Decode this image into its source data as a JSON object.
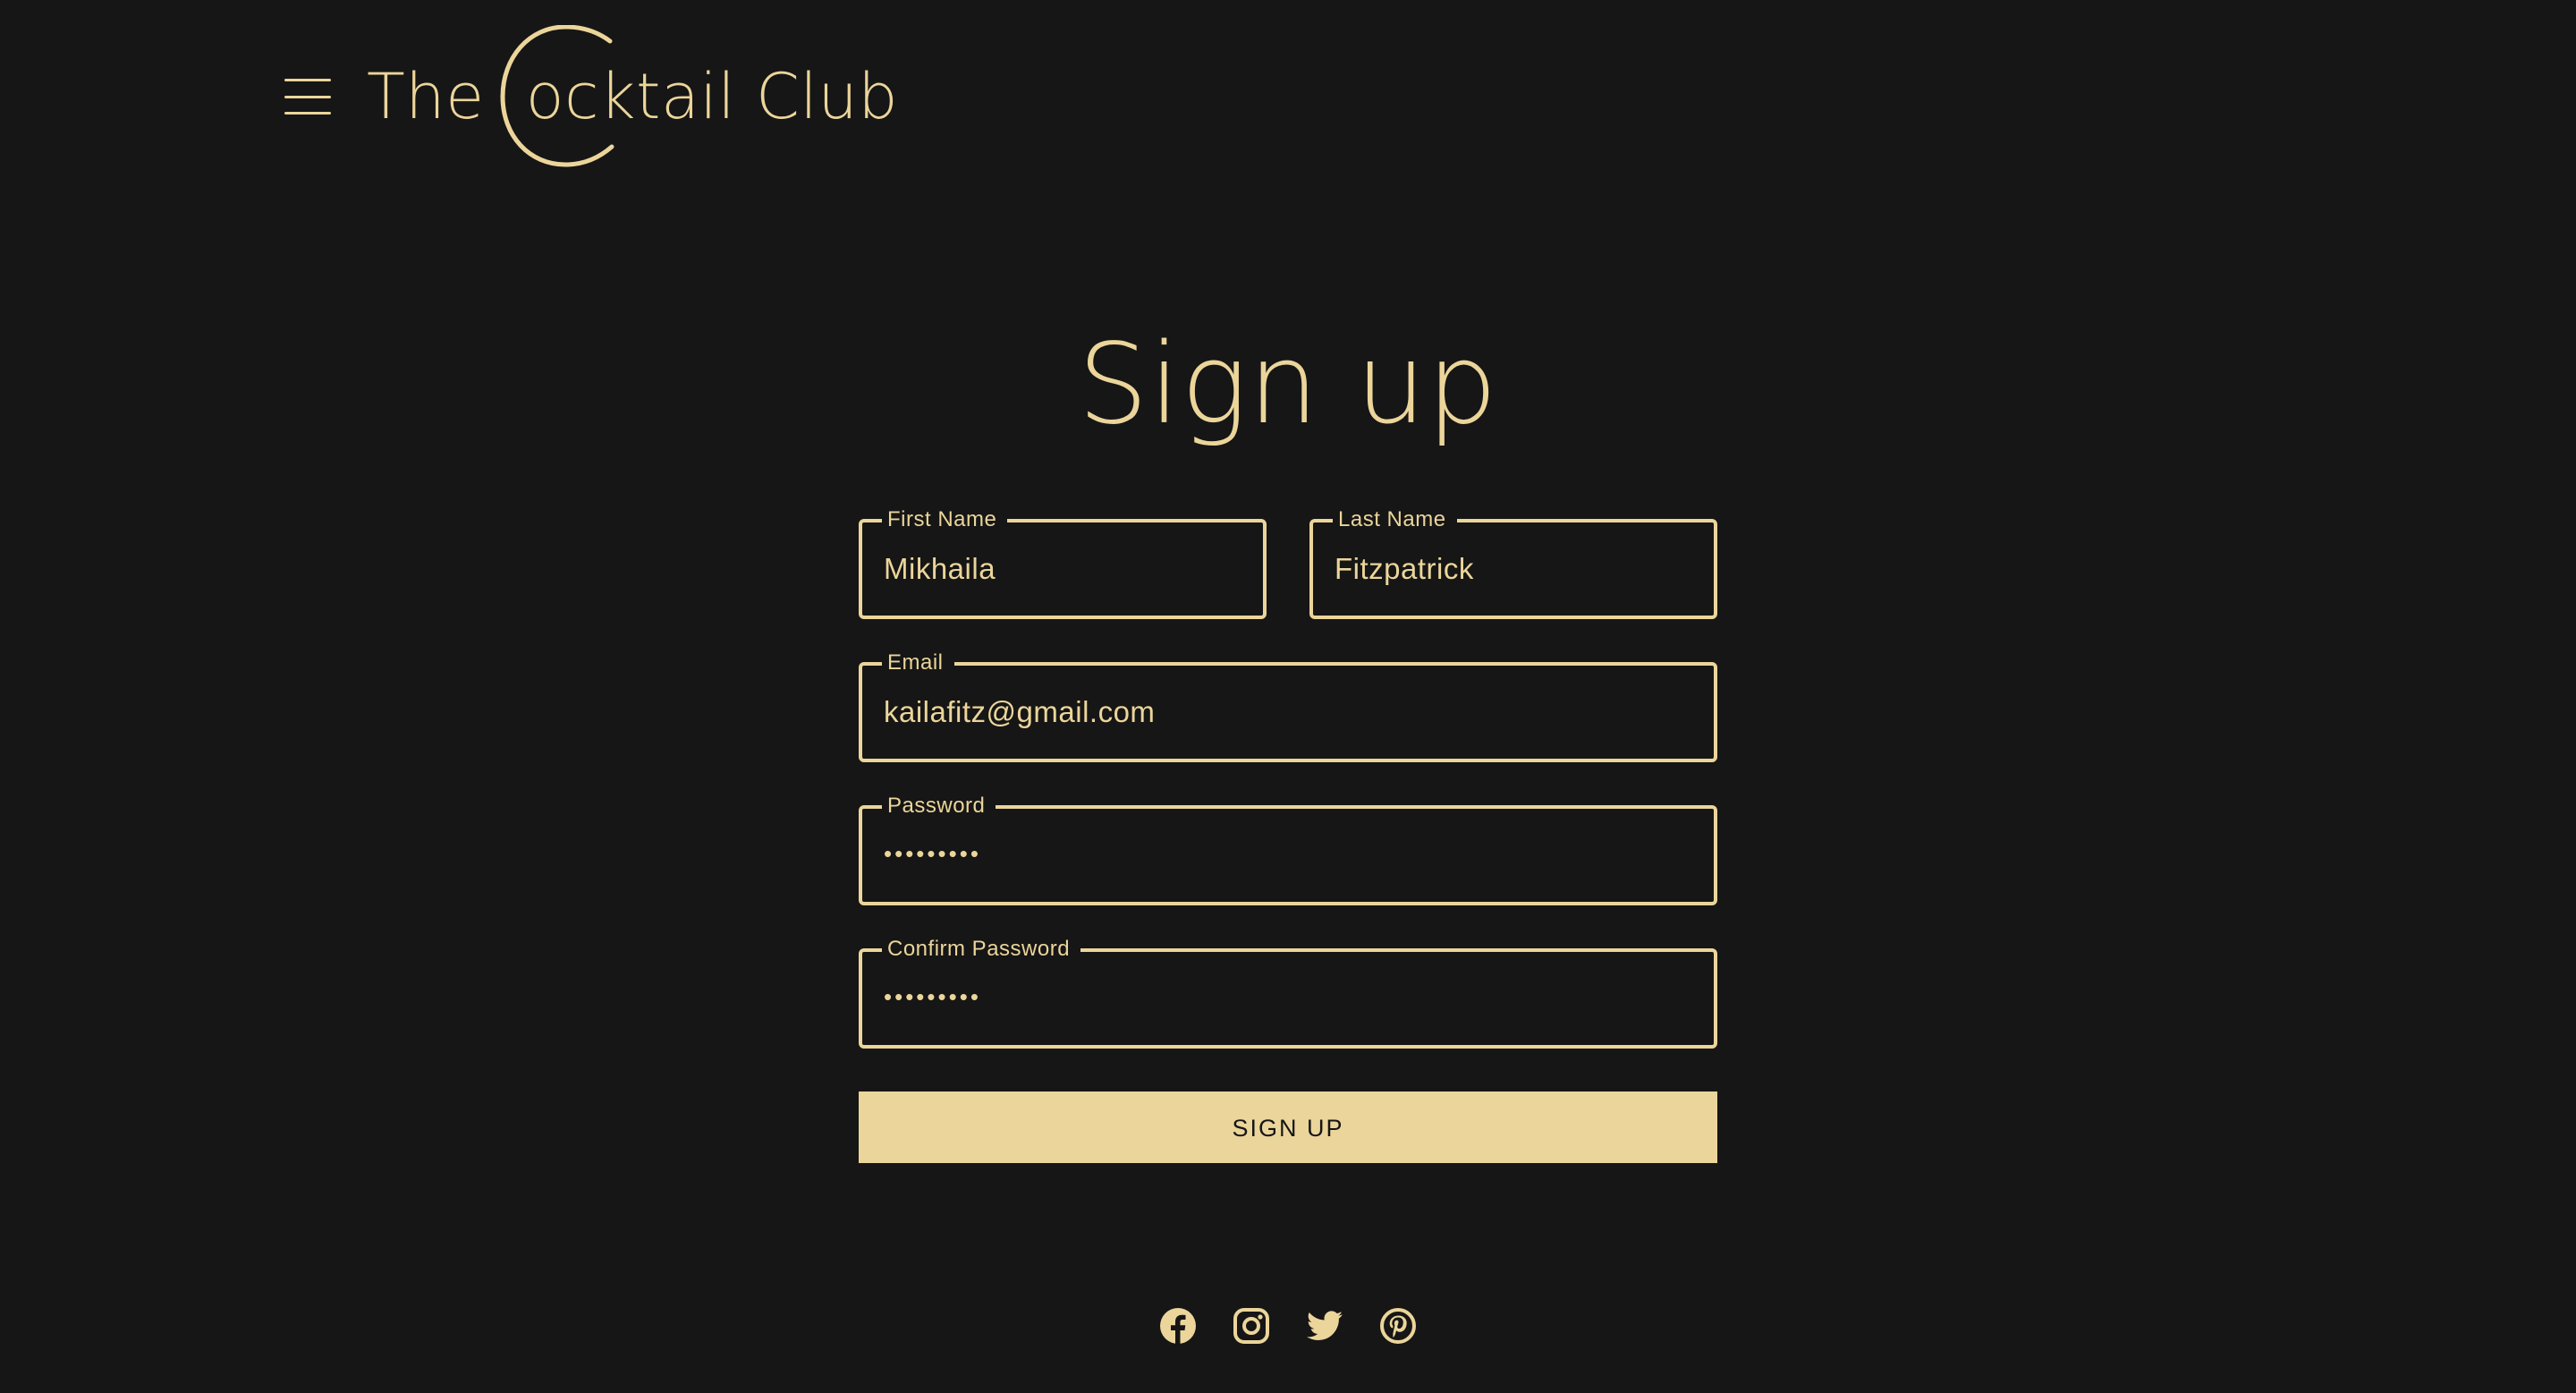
{
  "header": {
    "menu_icon": "hamburger-menu-icon",
    "logo": {
      "word_the": "The",
      "letter_c": "C",
      "word_rest": "ocktail Club",
      "full_name": "The Cocktail Club"
    }
  },
  "page": {
    "title": "Sign up"
  },
  "form": {
    "first_name": {
      "label": "First Name",
      "value": "Mikhaila"
    },
    "last_name": {
      "label": "Last Name",
      "value": "Fitzpatrick"
    },
    "email": {
      "label": "Email",
      "value": "kailafitz@gmail.com"
    },
    "password": {
      "label": "Password",
      "value": "•••••••••"
    },
    "confirm_password": {
      "label": "Confirm Password",
      "value": "•••••••••"
    },
    "submit_label": "SIGN UP"
  },
  "social": {
    "icons": [
      "facebook-icon",
      "instagram-icon",
      "twitter-icon",
      "pinterest-icon"
    ]
  },
  "colors": {
    "background": "#161616",
    "accent": "#ebd59a",
    "button_text": "#161616"
  }
}
